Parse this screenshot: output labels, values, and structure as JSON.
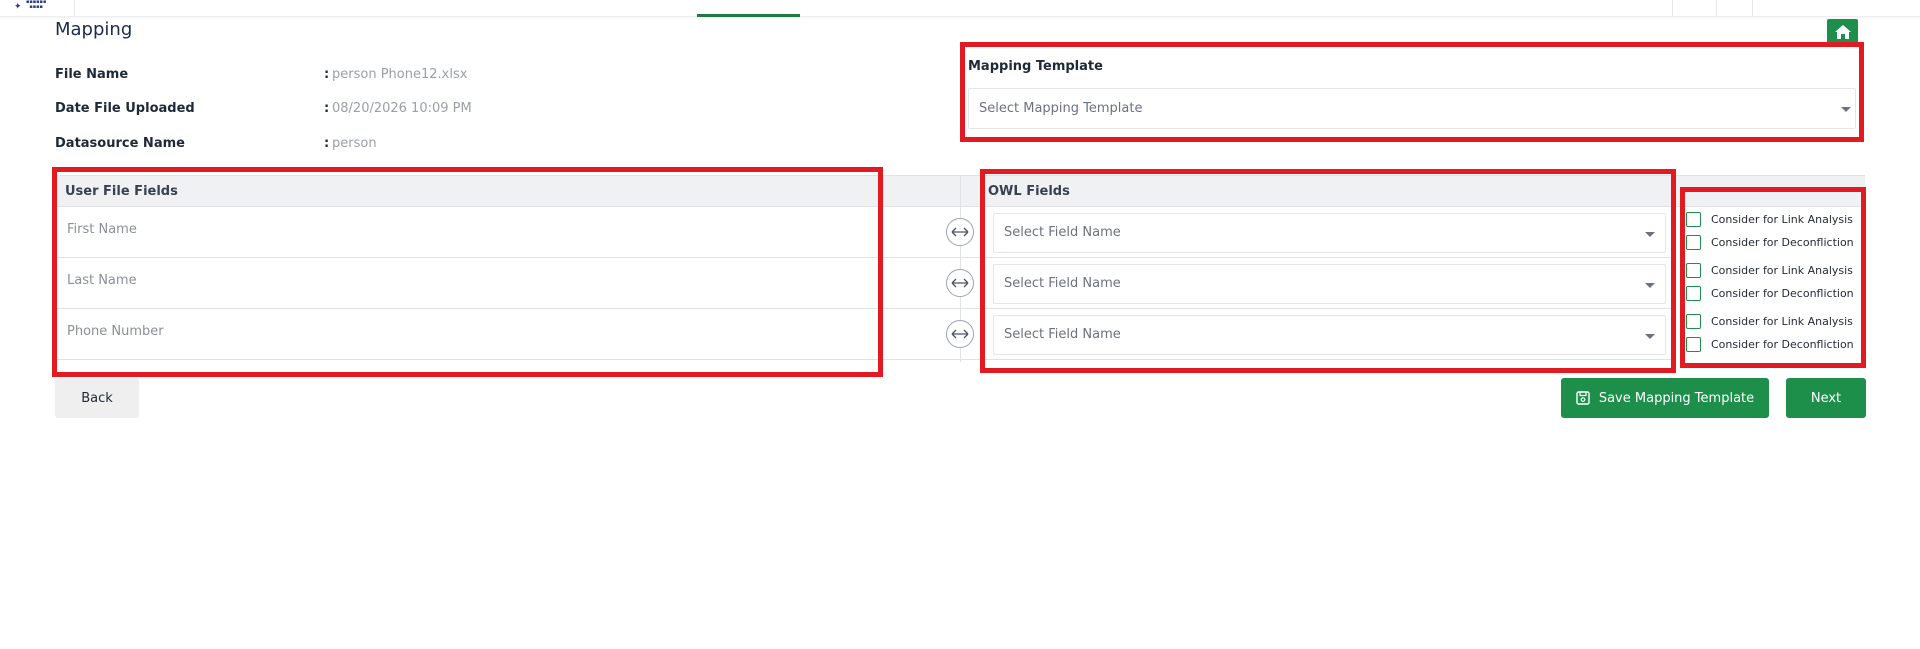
{
  "page": {
    "title": "Mapping"
  },
  "info": [
    {
      "label": "File Name",
      "value": "person Phone12.xlsx"
    },
    {
      "label": "Date File Uploaded",
      "value": "08/20/2026 10:09 PM"
    },
    {
      "label": "Datasource Name",
      "value": "person"
    }
  ],
  "info_separator": ":",
  "mapping_template": {
    "label": "Mapping Template",
    "placeholder": "Select Mapping Template"
  },
  "table": {
    "user_fields_header": "User File Fields",
    "owl_fields_header": "OWL Fields",
    "rows": [
      {
        "user_field": "First Name",
        "owl_placeholder": "Select Field Name",
        "link_analysis": "Consider for Link Analysis",
        "deconfliction": "Consider for Deconfliction"
      },
      {
        "user_field": "Last Name",
        "owl_placeholder": "Select Field Name",
        "link_analysis": "Consider for Link Analysis",
        "deconfliction": "Consider for Deconfliction"
      },
      {
        "user_field": "Phone Number",
        "owl_placeholder": "Select Field Name",
        "link_analysis": "Consider for Link Analysis",
        "deconfliction": "Consider for Deconfliction"
      }
    ]
  },
  "buttons": {
    "back": "Back",
    "save_template": "Save Mapping Template",
    "next": "Next"
  },
  "icons": {
    "home": "home-icon",
    "link": "bidirectional-arrow-icon",
    "save": "save-icon",
    "caret": "caret-down-icon"
  },
  "colors": {
    "accent": "#1e8f4b",
    "annotation": "#e21b23",
    "title": "#1c2a4d"
  }
}
